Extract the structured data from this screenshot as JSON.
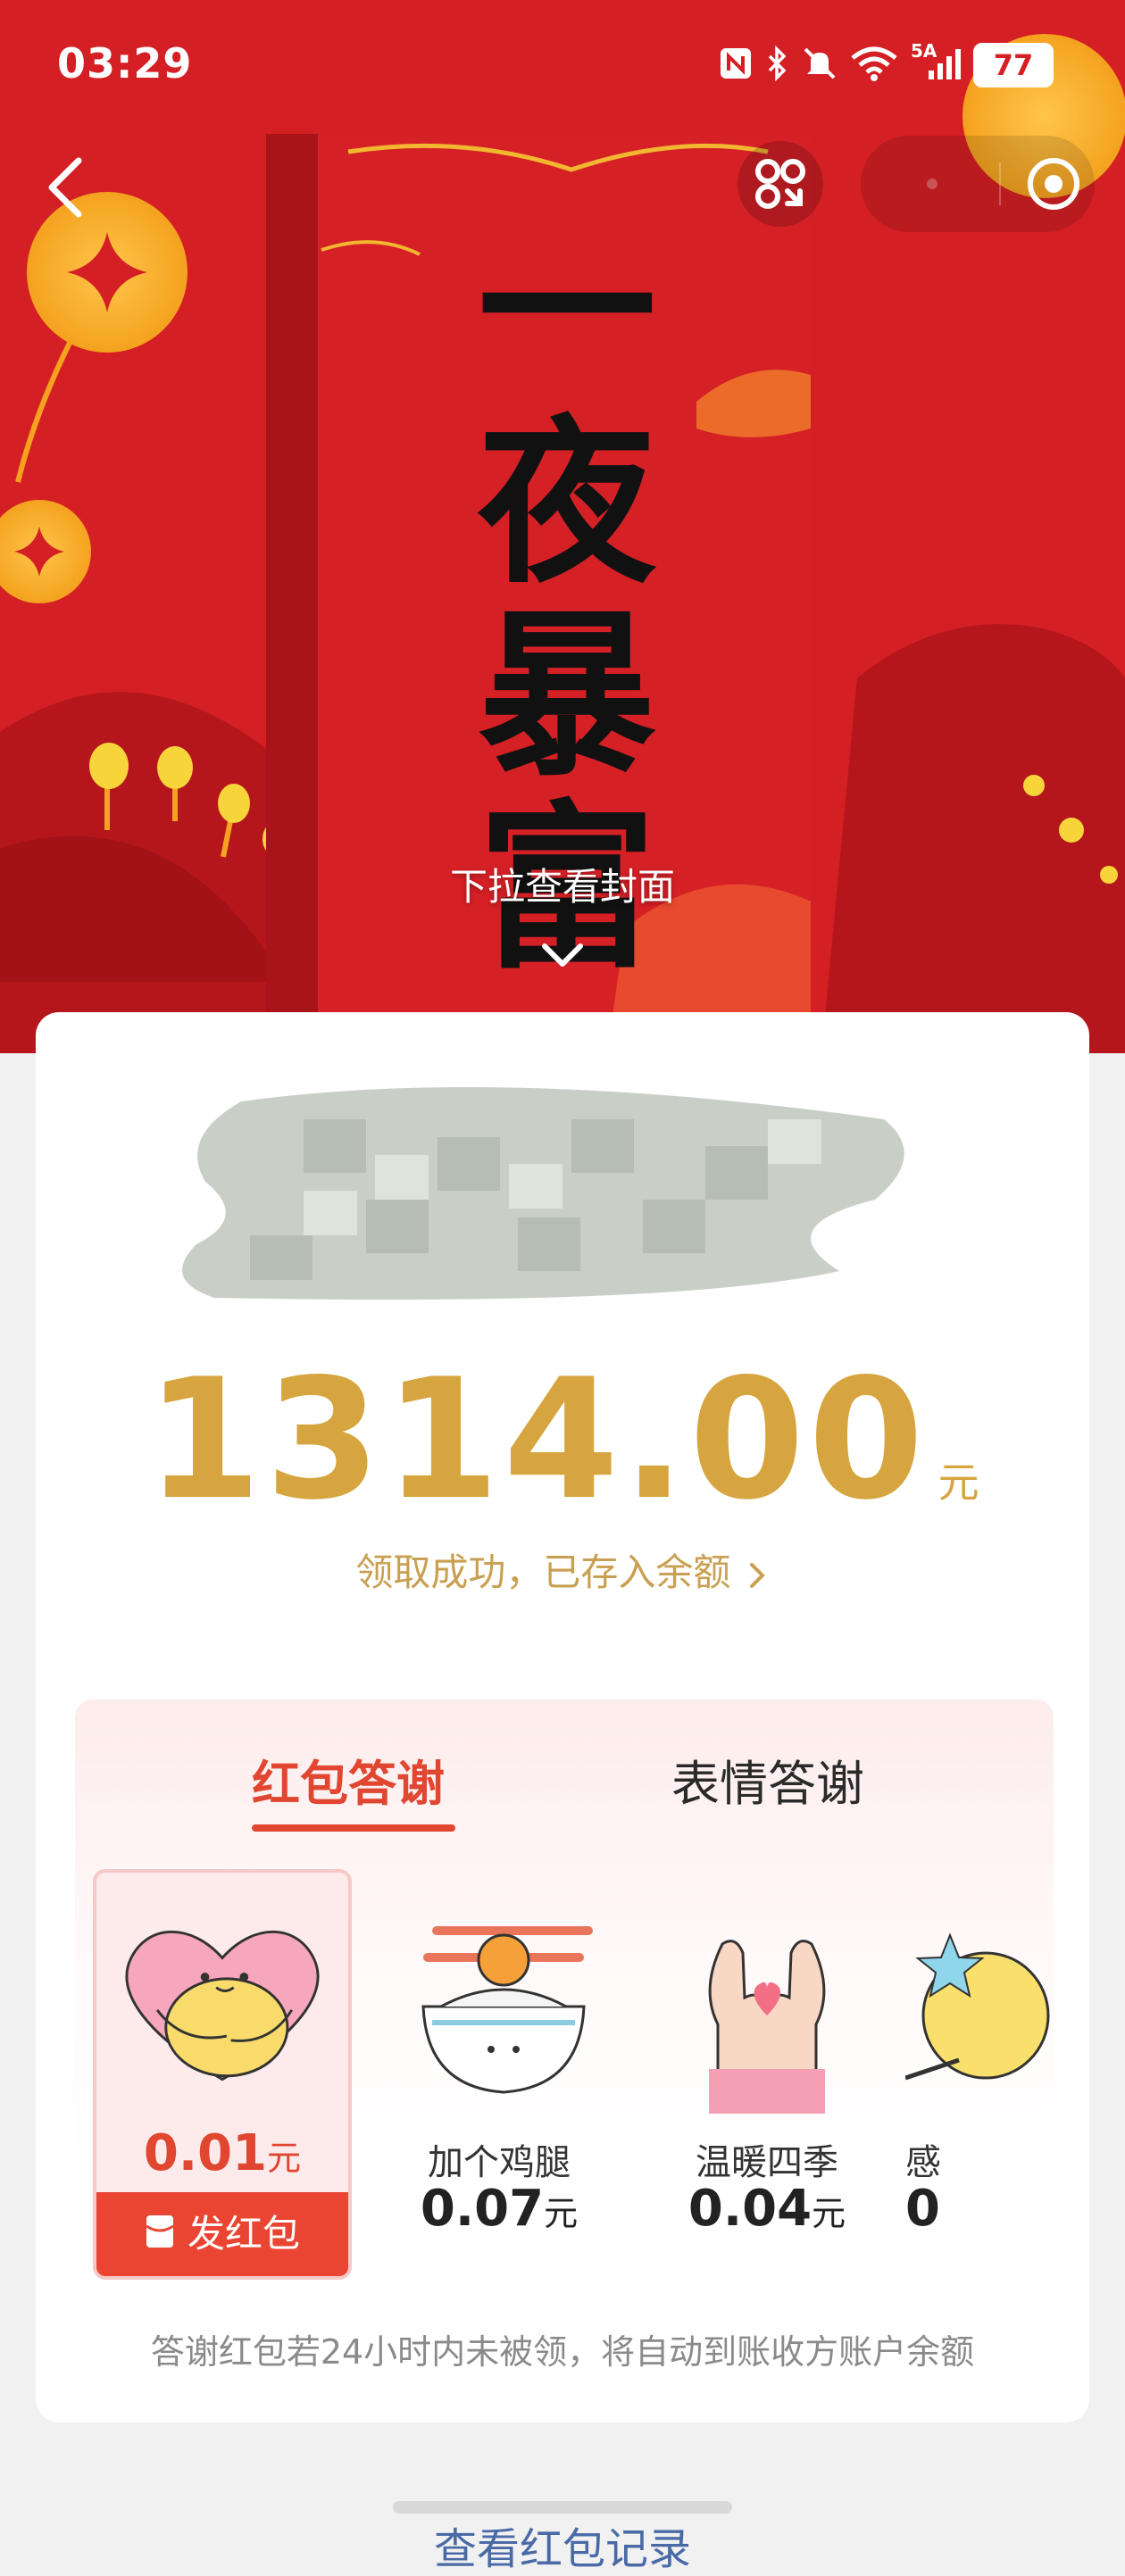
{
  "status_bar": {
    "time": "03:29",
    "icons": [
      "nfc-icon",
      "bluetooth-icon",
      "mute-icon",
      "wifi-icon",
      "signal-icon"
    ],
    "network_label": "5A",
    "battery": "77"
  },
  "header": {
    "back_icon": "chevron-left-icon",
    "scan_icon": "scan-icon",
    "capsule_icon": "target-icon"
  },
  "cover": {
    "calligraphy": "一夜暴富",
    "hint": "下拉查看封面",
    "hint_icon": "chevron-down-icon"
  },
  "red_packet": {
    "amount": "1314.00",
    "unit": "元",
    "status": "领取成功，已存入余额",
    "status_icon": "chevron-right-icon"
  },
  "thanks": {
    "tabs": [
      {
        "label": "红包答谢",
        "active": true
      },
      {
        "label": "表情答谢",
        "active": false
      }
    ],
    "gifts": [
      {
        "name": "",
        "price": "0.01",
        "unit": "元",
        "icon": "hug-heart-icon",
        "selected": true
      },
      {
        "name": "加个鸡腿",
        "price": "0.07",
        "unit": "元",
        "icon": "drumstick-bowl-icon",
        "selected": false
      },
      {
        "name": "温暖四季",
        "price": "0.04",
        "unit": "元",
        "icon": "heart-hands-icon",
        "selected": false
      },
      {
        "name": "感",
        "price": "0",
        "unit": "",
        "icon": "star-icon",
        "selected": false
      }
    ],
    "send_button": "发红包",
    "send_icon": "red-envelope-icon",
    "footnote": "答谢红包若24小时内未被领，将自动到账收方账户余额"
  },
  "bottom": {
    "link": "查看红包记录"
  },
  "colors": {
    "hero_red": "#d41f24",
    "gold": "#d6a53f",
    "accent": "#e04630"
  }
}
